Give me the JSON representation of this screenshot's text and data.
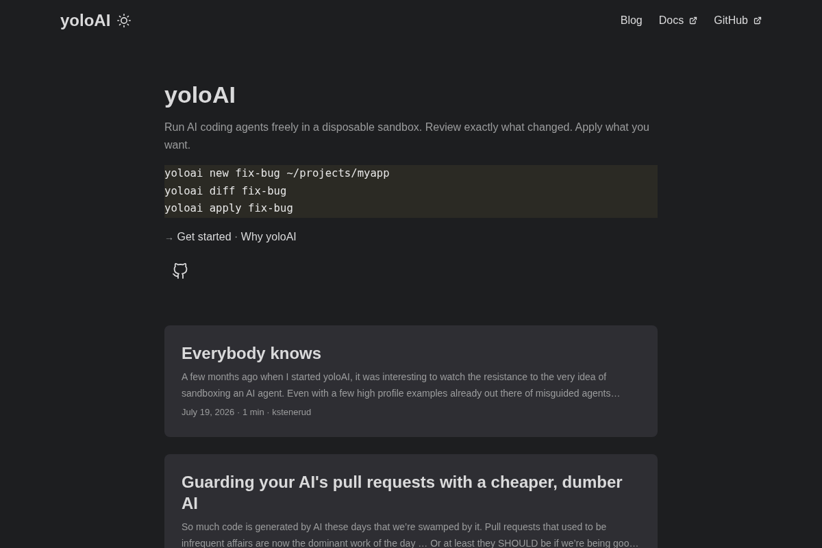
{
  "header": {
    "logo": "yoloAI",
    "nav": [
      {
        "label": "Blog",
        "external": false
      },
      {
        "label": "Docs",
        "external": true
      },
      {
        "label": "GitHub",
        "external": true
      }
    ]
  },
  "hero": {
    "title": "yoloAI",
    "tagline": "Run AI coding agents freely in a disposable sandbox. Review exactly what changed. Apply what you want.",
    "code_lines": [
      "yoloai new fix-bug ~/projects/myapp",
      "yoloai diff fix-bug",
      "yoloai apply fix-bug"
    ],
    "links_prefix": "→",
    "separator": "·",
    "links": [
      "Get started",
      "Why yoloAI"
    ]
  },
  "posts": [
    {
      "title": "Everybody knows",
      "summary": "A few months ago when I started yoloAI, it was interesting to watch the resistance to the very idea of sandboxing an AI agent. Even with a few high profile examples already out there of misguided agents…",
      "meta": "July 19, 2026 · 1 min · kstenerud"
    },
    {
      "title": "Guarding your AI's pull requests with a cheaper, dumber AI",
      "summary": "So much code is generated by AI these days that we’re swamped by it. Pull requests that used to be infrequent affairs are now the dominant work of the day … Or at least they SHOULD be if we’re being goo…"
    }
  ]
}
